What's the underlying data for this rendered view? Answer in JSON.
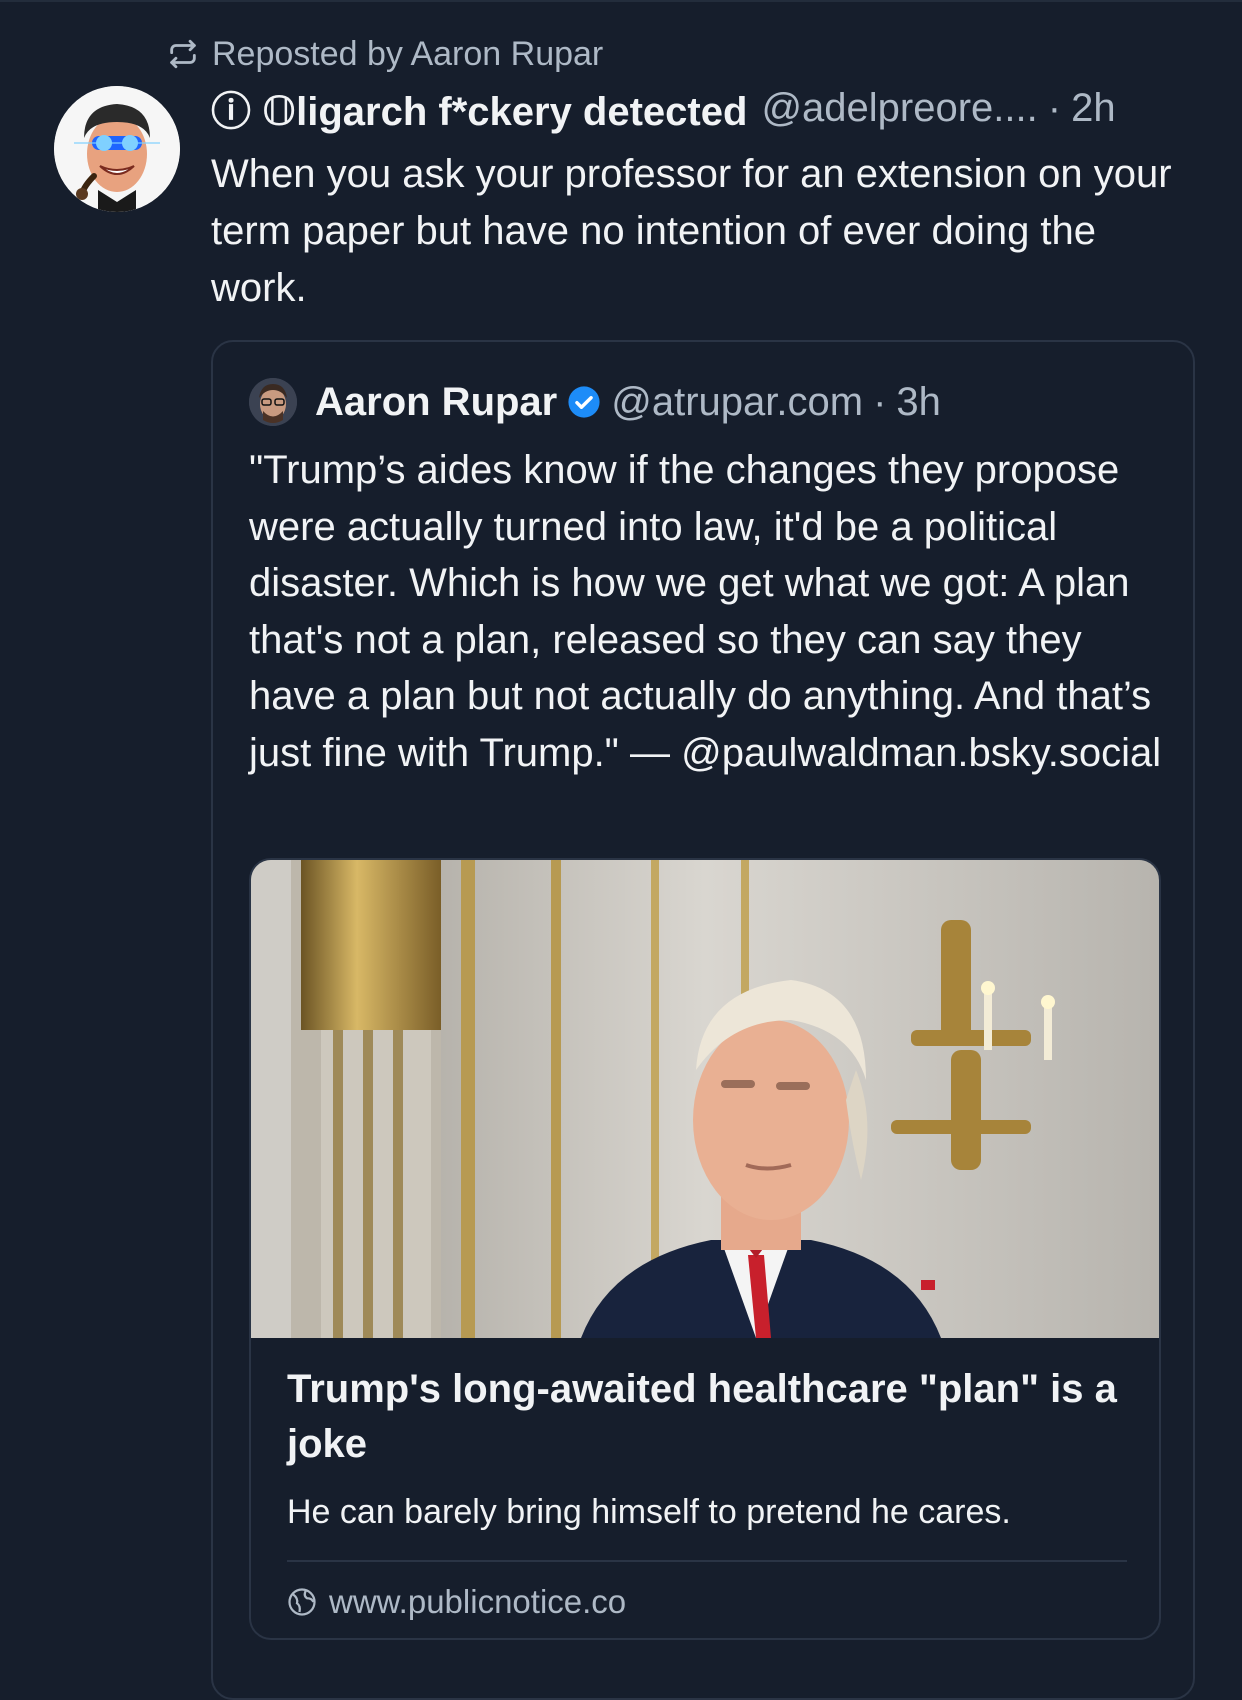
{
  "repost": {
    "label": "Reposted by Aaron Rupar",
    "icon": "repost-icon"
  },
  "post": {
    "display_name": "ⓘ 𝕆ligarch f*ckery detected",
    "handle": "@adelpreore....",
    "separator": "·",
    "time": "2h",
    "text": "When you ask your professor for an extension on your term paper but have no intention of ever doing the work."
  },
  "quote": {
    "display_name": "Aaron Rupar",
    "verified_icon": "verified-badge-icon",
    "handle": "@atrupar.com",
    "separator": "·",
    "time": "3h",
    "text": "\"Trump’s aides know if the changes they propose were actually turned into law, it'd be a political disaster. Which is how we get what we got: A plan that's not a plan, released so they can say they have a plan but not actually do anything. And that’s just fine with Trump.\" — @paulwaldman.bsky.social"
  },
  "link_card": {
    "title": "Trump's long-awaited healthcare \"plan\" is a joke",
    "description": "He can barely bring himself to pretend he cares.",
    "domain": "www.publicnotice.co",
    "domain_icon": "globe-icon"
  },
  "colors": {
    "background": "#161e2c",
    "text_primary": "#f1f3f5",
    "text_secondary": "#aeb9c6",
    "border": "#2a3445",
    "verified": "#1d8cf8"
  }
}
